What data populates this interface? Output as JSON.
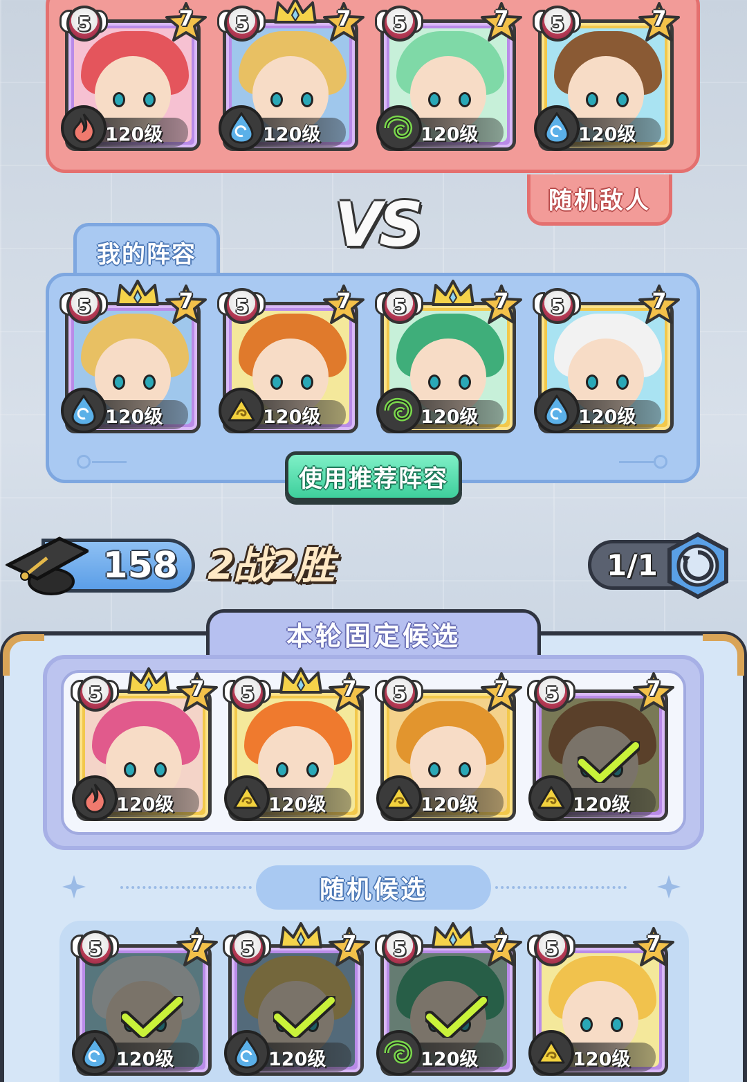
{
  "enemy": {
    "label": "随机敌人",
    "heroes": [
      {
        "name": "fire-heroine",
        "level_badge": "5",
        "stars": "7",
        "level": "120级",
        "element": "fire",
        "crown": false,
        "frame": "purple",
        "selected": false,
        "palette": {
          "bg": "#f6c1d2",
          "hair": "#e4555c"
        }
      },
      {
        "name": "golden-queen",
        "level_badge": "5",
        "stars": "7",
        "level": "120级",
        "element": "water",
        "crown": true,
        "frame": "purple",
        "selected": false,
        "palette": {
          "bg": "#9fc7ec",
          "hair": "#e8c063"
        }
      },
      {
        "name": "green-sorceress",
        "level_badge": "5",
        "stars": "7",
        "level": "120级",
        "element": "wind",
        "crown": false,
        "frame": "purple",
        "selected": false,
        "palette": {
          "bg": "#c7f0d9",
          "hair": "#7fd9a7"
        }
      },
      {
        "name": "armored-golem",
        "level_badge": "5",
        "stars": "7",
        "level": "120级",
        "element": "water",
        "crown": false,
        "frame": "gold",
        "selected": false,
        "palette": {
          "bg": "#a9e3f2",
          "hair": "#8a5a34"
        }
      }
    ]
  },
  "vs_text": "VS",
  "mine": {
    "label": "我的阵容",
    "recommend_button": "使用推荐阵容",
    "heroes": [
      {
        "name": "golden-queen",
        "level_badge": "5",
        "stars": "7",
        "level": "120级",
        "element": "water",
        "crown": true,
        "frame": "purple",
        "selected": false,
        "palette": {
          "bg": "#9fc7ec",
          "hair": "#e8c063"
        }
      },
      {
        "name": "tiger-warrior",
        "level_badge": "5",
        "stars": "7",
        "level": "120级",
        "element": "earth",
        "crown": false,
        "frame": "purple",
        "selected": false,
        "palette": {
          "bg": "#f4e89b",
          "hair": "#e07a2c"
        }
      },
      {
        "name": "jade-elf",
        "level_badge": "5",
        "stars": "7",
        "level": "120级",
        "element": "wind",
        "crown": true,
        "frame": "gold",
        "selected": false,
        "palette": {
          "bg": "#c7f0d9",
          "hair": "#3fae7a"
        }
      },
      {
        "name": "goggles-girl",
        "level_badge": "5",
        "stars": "7",
        "level": "120级",
        "element": "water",
        "crown": false,
        "frame": "gold",
        "selected": false,
        "palette": {
          "bg": "#a9e3f2",
          "hair": "#f2f2f2"
        }
      }
    ]
  },
  "stats": {
    "score": "158",
    "record": "2战2胜",
    "refresh": "1/1"
  },
  "fixed_candidates": {
    "title": "本轮固定候选",
    "heroes": [
      {
        "name": "pink-adventurer",
        "level_badge": "5",
        "stars": "7",
        "level": "120级",
        "element": "fire",
        "crown": true,
        "frame": "gold",
        "selected": false,
        "palette": {
          "bg": "#f4d4c8",
          "hair": "#e15a8c"
        }
      },
      {
        "name": "orange-fighter",
        "level_badge": "5",
        "stars": "7",
        "level": "120级",
        "element": "earth",
        "crown": true,
        "frame": "gold",
        "selected": false,
        "palette": {
          "bg": "#f4e89b",
          "hair": "#ef7a2e"
        }
      },
      {
        "name": "bearded-sage",
        "level_badge": "5",
        "stars": "7",
        "level": "120级",
        "element": "earth",
        "crown": false,
        "frame": "gold",
        "selected": false,
        "palette": {
          "bg": "#f4d28b",
          "hair": "#e2952e"
        }
      },
      {
        "name": "tiger-warrior",
        "level_badge": "5",
        "stars": "7",
        "level": "120级",
        "element": "earth",
        "crown": false,
        "frame": "purple",
        "selected": true,
        "palette": {
          "bg": "#f4e89b",
          "hair": "#b06a3a"
        }
      }
    ]
  },
  "random_candidates": {
    "title": "随机候选",
    "heroes": [
      {
        "name": "goggles-girl",
        "level_badge": "5",
        "stars": "7",
        "level": "120级",
        "element": "water",
        "crown": false,
        "frame": "purple",
        "selected": true,
        "palette": {
          "bg": "#a9e3f2",
          "hair": "#f2f2f2"
        }
      },
      {
        "name": "golden-queen",
        "level_badge": "5",
        "stars": "7",
        "level": "120级",
        "element": "water",
        "crown": true,
        "frame": "purple",
        "selected": true,
        "palette": {
          "bg": "#9fc7ec",
          "hair": "#e8c063"
        }
      },
      {
        "name": "jade-elf",
        "level_badge": "5",
        "stars": "7",
        "level": "120级",
        "element": "wind",
        "crown": true,
        "frame": "purple",
        "selected": true,
        "palette": {
          "bg": "#c7f0d9",
          "hair": "#3fae7a"
        }
      },
      {
        "name": "blonde-girl",
        "level_badge": "5",
        "stars": "7",
        "level": "120级",
        "element": "earth",
        "crown": false,
        "frame": "purple",
        "selected": false,
        "palette": {
          "bg": "#f4e89b",
          "hair": "#f1c24d"
        }
      }
    ]
  },
  "element_colors": {
    "fire": "#f07a6e",
    "water": "#5bb0e8",
    "wind": "#7ad84c",
    "earth": "#f3d23e"
  }
}
